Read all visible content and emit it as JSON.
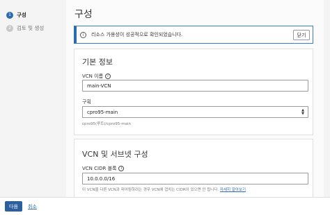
{
  "steps": [
    {
      "num": "1",
      "label": "구성",
      "active": true
    },
    {
      "num": "2",
      "label": "검토 및 생성",
      "active": false
    }
  ],
  "page_title": "구성",
  "alert": {
    "icon": "i",
    "text": "리소스 가용성이 성공적으로 확인되었습니다.",
    "close_label": "닫기"
  },
  "basic_info": {
    "title": "기본 정보",
    "vcn_name_label": "VCN 이름",
    "vcn_name_value": "main-VCN",
    "compartment_label": "구획",
    "compartment_value": "cpro95-main",
    "compartment_path": "cpro95(루트)/cpro95-main"
  },
  "vcn_subnet": {
    "title": "VCN 및 서브넷 구성",
    "cidr_label": "VCN CIDR 블록",
    "cidr_value": "10.0.0.0/16",
    "cidr_hint": "이 VCN을 다른 VCN과 피어링하려는 경우 VCN에 겹치는 CIDR이 있으면 안 됩니다.",
    "cidr_hint_link": "자세히 알아보기"
  },
  "footer": {
    "next_label": "다음",
    "cancel_label": "취소"
  }
}
